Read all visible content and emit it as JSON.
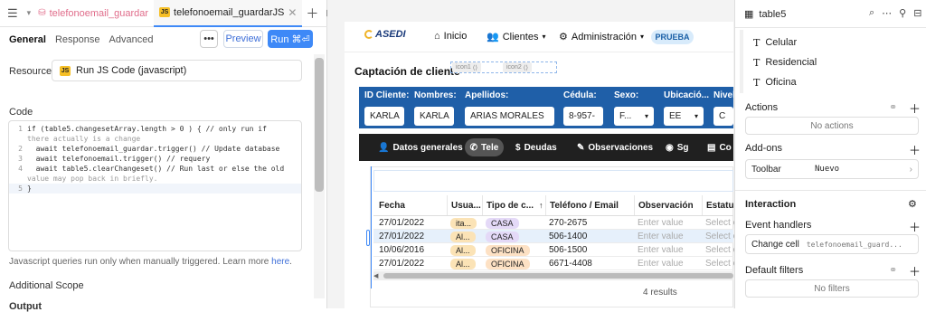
{
  "tabs": [
    {
      "label": "telefonoemail_guardar"
    },
    {
      "label": "telefonoemail_guardarJS"
    }
  ],
  "subtabs": [
    "General",
    "Response",
    "Advanced"
  ],
  "toolbar": {
    "more": "•••",
    "preview": "Preview",
    "run": "Run ⌘⏎"
  },
  "resource": {
    "label": "Resource",
    "value": "Run JS Code (javascript)",
    "badge": "JS"
  },
  "code": {
    "label": "Code",
    "lines": [
      {
        "n": "1",
        "text": "if (table5.changesetArray.length > 0 ) { // only run if"
      },
      {
        "n": "",
        "text": "there actually is a change"
      },
      {
        "n": "2",
        "text": "  await telefonoemail_guardar.trigger() // Update database"
      },
      {
        "n": "3",
        "text": "  await telefonoemail.trigger() // requery"
      },
      {
        "n": "4",
        "text": "  await table5.clearChangeset() // Run last or else the old"
      },
      {
        "n": "",
        "text": "value may pop back in briefly."
      },
      {
        "n": "5",
        "text": "}"
      }
    ]
  },
  "hint": {
    "text": "Javascript queries run only when manually triggered. Learn more ",
    "link": "here",
    "after": "."
  },
  "additional_scope": "Additional Scope",
  "output": "Output",
  "app": {
    "logo": "ASEDI",
    "nav": {
      "inicio": "Inicio",
      "clientes": "Clientes",
      "admin": "Administración"
    },
    "badge": "PRUEBA",
    "title": "Captación de cliente",
    "tags": [
      "icon1",
      "icon2"
    ],
    "form": {
      "labels": [
        "ID Cliente:",
        "Nombres:",
        "Apellidos:",
        "Cédula:",
        "Sexo:",
        "Ubicació...",
        "Nivel"
      ],
      "values": [
        "KARLA",
        "KARLA",
        "ARIAS MORALES",
        "8-957-",
        "F...",
        "EE",
        "C"
      ]
    },
    "tabs": [
      "Datos generales",
      "Tele",
      "Deudas",
      "Observaciones",
      "Sg",
      "Co"
    ],
    "table": {
      "headers": [
        "Fecha",
        "Usua...",
        "Tipo de c...",
        "Teléfono / Email",
        "Observación",
        "Estatus"
      ],
      "rows": [
        {
          "fecha": "27/01/2022",
          "user": "ita...",
          "tipo": "CASA",
          "tel": "270-2675",
          "obs": "Enter value",
          "est": "Select o"
        },
        {
          "fecha": "27/01/2022",
          "user": "Al...",
          "tipo": "CASA",
          "tel": "506-1400",
          "obs": "Enter value",
          "est": "Select o"
        },
        {
          "fecha": "10/06/2016",
          "user": "Al...",
          "tipo": "OFICINA",
          "tel": "506-1500",
          "obs": "Enter value",
          "est": "Select o"
        },
        {
          "fecha": "27/01/2022",
          "user": "Al...",
          "tipo": "OFICINA",
          "tel": "6671-4408",
          "obs": "Enter value",
          "est": "Select o"
        }
      ],
      "footer": "4 results"
    }
  },
  "inspector": {
    "component": "table5",
    "columns": [
      "Celular",
      "Residencial",
      "Oficina"
    ],
    "actions": "Actions",
    "no_actions": "No actions",
    "addons": "Add-ons",
    "toolbar_label": "Toolbar",
    "toolbar_value": "Nuevo",
    "interaction": "Interaction",
    "event_handlers": "Event handlers",
    "change_cell": "Change cell",
    "change_cell_value": "telefonoemail_guard...",
    "default_filters": "Default filters",
    "no_filters": "No filters"
  },
  "colors": {
    "accent": "#3e89f7",
    "form_band": "#1f5fa8",
    "tab_band": "#202020",
    "casa_pill": "#e4d9f7",
    "oficina_pill": "#fde1c4",
    "user_pill": "#fbe3b6"
  }
}
